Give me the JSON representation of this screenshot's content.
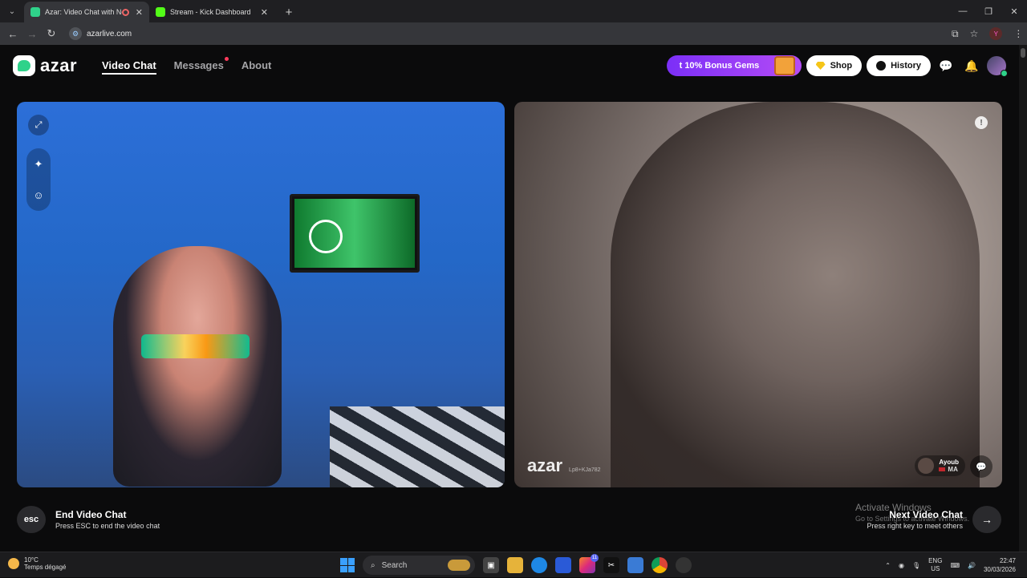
{
  "browser": {
    "tabs": [
      {
        "title": "Azar: Video Chat with New",
        "active": true,
        "favicon_color": "#2fd28a"
      },
      {
        "title": "Stream - Kick Dashboard",
        "active": false,
        "favicon_color": "#53fc18"
      }
    ],
    "url": "azarlive.com",
    "profile_initial": "Y"
  },
  "app": {
    "logo_text": "azar",
    "nav": [
      {
        "label": "Video Chat"
      },
      {
        "label": "Messages"
      },
      {
        "label": "About"
      }
    ],
    "gems_label": "t 10% Bonus Gems",
    "shop_label": "Shop",
    "history_label": "History"
  },
  "videos": {
    "right": {
      "watermark": "azar",
      "watermark_id": "Lp8+KJa782",
      "partner_name": "Ayoub",
      "partner_country": "MA"
    }
  },
  "controls": {
    "esc_key": "esc",
    "end_title": "End Video Chat",
    "end_sub": "Press ESC to end the video chat",
    "next_title": "Next Video Chat",
    "next_sub": "Press right key to meet others"
  },
  "windows_overlay": {
    "title": "Activate Windows",
    "sub": "Go to Settings to activate Windows."
  },
  "taskbar": {
    "temp": "10°C",
    "weather": "Temps dégagé",
    "search_placeholder": "Search",
    "lang_top": "ENG",
    "lang_bottom": "US",
    "time": "22:47",
    "date": "30/03/2026",
    "instagram_badge": "11"
  },
  "colors": {
    "accent_green": "#2fd28a",
    "gems_purple": "#7b2ff7",
    "notification_red": "#ff3b5c"
  }
}
